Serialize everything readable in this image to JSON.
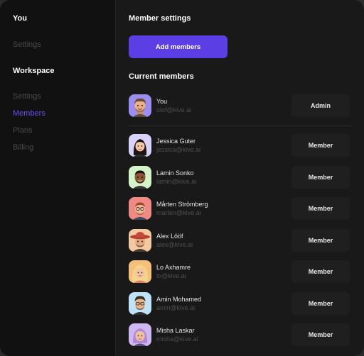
{
  "sidebar": {
    "you_heading": "You",
    "you_items": [
      {
        "label": "Settings"
      }
    ],
    "workspace_heading": "Workspace",
    "workspace_items": [
      {
        "label": "Settings"
      },
      {
        "label": "Members",
        "active": true
      },
      {
        "label": "Plans"
      },
      {
        "label": "Billing"
      }
    ],
    "active_color": "#6a4ff2"
  },
  "main": {
    "title": "Member settings",
    "add_button_label": "Add members",
    "accent_color": "#5b3fe4",
    "current_members_title": "Current members",
    "members": [
      {
        "name": "You",
        "email": "olof@kive.ai",
        "role": "Admin",
        "avatar_bg": "#9b8ef0"
      },
      {
        "name": "Jessica Guter",
        "email": "jessica@kive.ai",
        "role": "Member",
        "avatar_bg": "#d9d3fb"
      },
      {
        "name": "Lamin Sonko",
        "email": "lamin@kive.ai",
        "role": "Member",
        "avatar_bg": "#d5f3c8"
      },
      {
        "name": "Mårten Strömberg",
        "email": "marten@kive.ai",
        "role": "Member",
        "avatar_bg": "#f08a86"
      },
      {
        "name": "Alex Lööf",
        "email": "alex@kive.ai",
        "role": "Member",
        "avatar_bg": "#f3c9a2"
      },
      {
        "name": "Lo Axhamre",
        "email": "lo@kive.ai",
        "role": "Member",
        "avatar_bg": "#f7c07a"
      },
      {
        "name": "Amin Mohamed",
        "email": "amin@kive.ai",
        "role": "Member",
        "avatar_bg": "#bfe3f7"
      },
      {
        "name": "Misha Laskar",
        "email": "misha@kive.ai",
        "role": "Member",
        "avatar_bg": "#cdb9ef"
      }
    ]
  }
}
